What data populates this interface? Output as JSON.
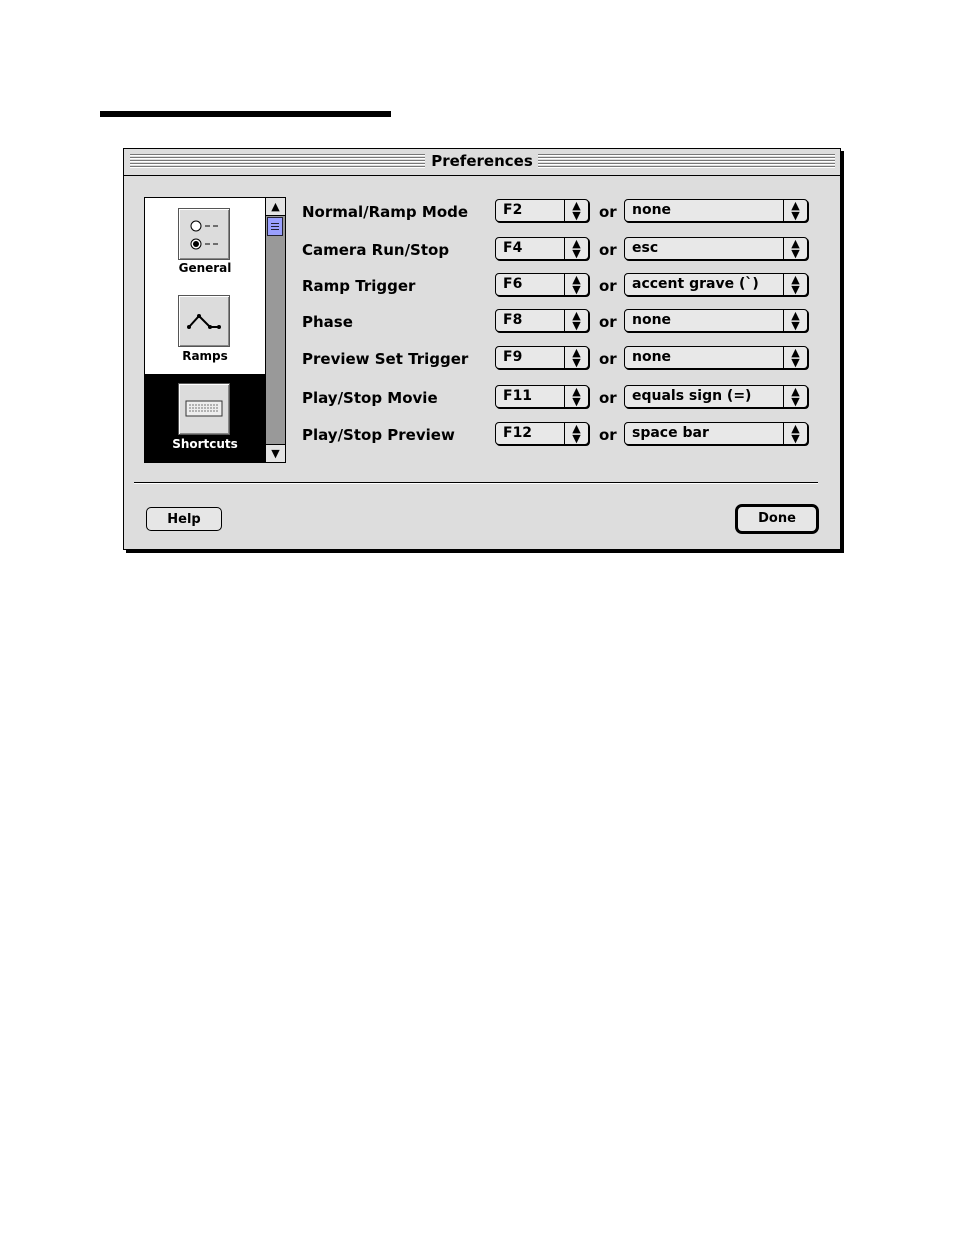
{
  "window": {
    "title": "Preferences"
  },
  "sidebar": {
    "panels": [
      {
        "label": "General",
        "icon": "radio-options-icon",
        "selected": false
      },
      {
        "label": "Ramps",
        "icon": "ramp-graph-icon",
        "selected": false
      },
      {
        "label": "Shortcuts",
        "icon": "keyboard-icon",
        "selected": true
      }
    ]
  },
  "shortcuts": [
    {
      "label": "Normal/Ramp Mode",
      "key": "F2",
      "or": "or",
      "alt": "none"
    },
    {
      "label": "Camera Run/Stop",
      "key": "F4",
      "or": "or",
      "alt": "esc"
    },
    {
      "label": "Ramp Trigger",
      "key": "F6",
      "or": "or",
      "alt": "accent grave (`)"
    },
    {
      "label": "Phase",
      "key": "F8",
      "or": "or",
      "alt": "none"
    },
    {
      "label": "Preview Set Trigger",
      "key": "F9",
      "or": "or",
      "alt": "none"
    },
    {
      "label": "Play/Stop Movie",
      "key": "F11",
      "or": "or",
      "alt": "equals sign (=)"
    },
    {
      "label": "Play/Stop Preview",
      "key": "F12",
      "or": "or",
      "alt": "space bar"
    }
  ],
  "buttons": {
    "help": "Help",
    "done": "Done"
  },
  "popup_arrow": "▲▼"
}
